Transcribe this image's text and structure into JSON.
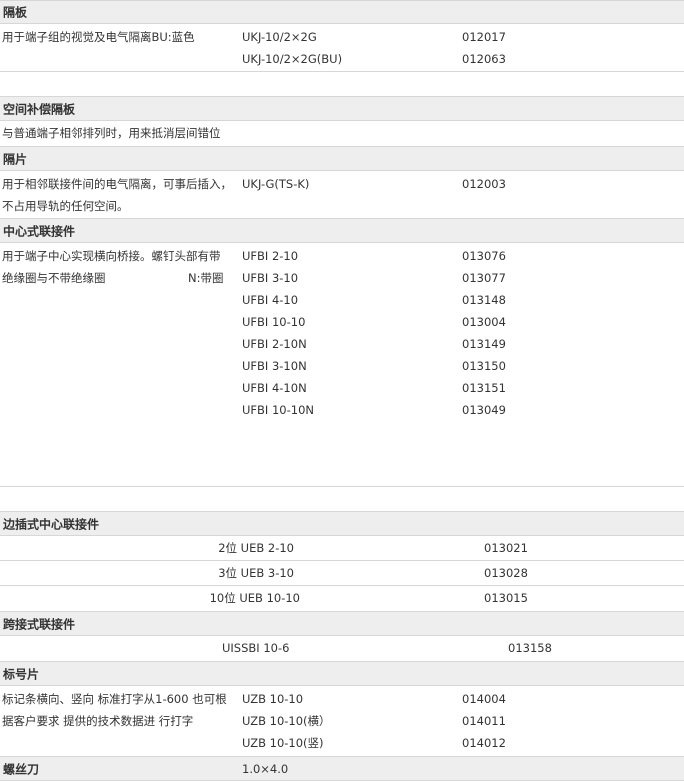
{
  "sections": [
    {
      "title": "隔板",
      "description": "用于端子组的视觉及电气隔离BU:蓝色",
      "items": [
        {
          "model": "UKJ-10/2×2G",
          "code": "012017"
        },
        {
          "model": "UKJ-10/2×2G(BU)",
          "code": "012063"
        }
      ]
    },
    {
      "title": "空间补偿隔板",
      "description": "与普通端子相邻排列时，用来抵消层间错位"
    },
    {
      "title": "隔片",
      "description": "用于相邻联接件间的电气隔离，可事后插入，不占用导轨的任何空间。",
      "items": [
        {
          "model": "UKJ-G(TS-K)",
          "code": "012003"
        }
      ]
    },
    {
      "title": "中心式联接件",
      "description_line1": "用于端子中心实现横向桥接。螺钉头部有带",
      "description_line2": "绝缘圈与不带绝缘圈",
      "note": "N:带圈",
      "items": [
        {
          "model": "UFBI 2-10",
          "code": "013076"
        },
        {
          "model": "UFBI 3-10",
          "code": "013077"
        },
        {
          "model": "UFBI 4-10",
          "code": "013148"
        },
        {
          "model": "UFBI 10-10",
          "code": "013004"
        },
        {
          "model": "UFBI 2-10N",
          "code": "013149"
        },
        {
          "model": "UFBI 3-10N",
          "code": "013150"
        },
        {
          "model": "UFBI 4-10N",
          "code": "013151"
        },
        {
          "model": "UFBI 10-10N",
          "code": "013049"
        }
      ]
    },
    {
      "title": "边插式中心联接件",
      "items": [
        {
          "label": "2位 UEB 2-10",
          "code": "013021"
        },
        {
          "label": "3位 UEB 3-10",
          "code": "013028"
        },
        {
          "label": "10位 UEB 10-10",
          "code": "013015"
        }
      ]
    },
    {
      "title": "跨接式联接件",
      "items": [
        {
          "model": "UISSBI  10-6",
          "code": "013158"
        }
      ]
    },
    {
      "title": "标号片",
      "description": "标记条横向、竖向 标准打字从1-600 也可根据客户要求 提供的技术数据进 行打字",
      "items": [
        {
          "model": "UZB 10-10",
          "code": "014004"
        },
        {
          "model": "UZB 10-10(横）",
          "code": "014011"
        },
        {
          "model": "UZB 10-10(竖)",
          "code": "014012"
        }
      ]
    },
    {
      "title": "螺丝刀",
      "items": [
        {
          "model": "1.0×4.0"
        }
      ]
    }
  ]
}
